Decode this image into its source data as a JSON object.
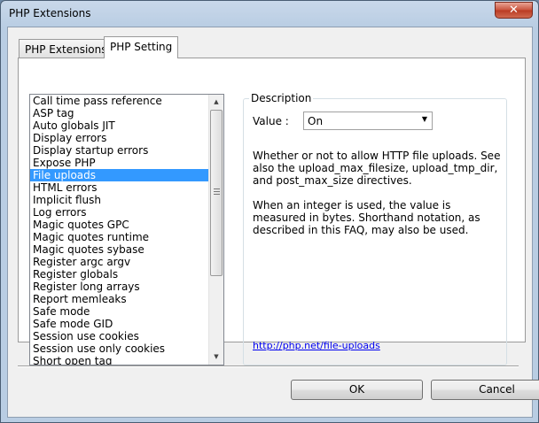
{
  "window": {
    "title": "PHP Extensions",
    "close_glyph": "✕"
  },
  "tabs": [
    {
      "label": "PHP Extensions",
      "active": false
    },
    {
      "label": "PHP Setting",
      "active": true
    }
  ],
  "settings_list": {
    "items": [
      "Call time pass reference",
      "ASP tag",
      "Auto globals JIT",
      "Display errors",
      "Display startup errors",
      "Expose PHP",
      "File uploads",
      "HTML errors",
      "Implicit flush",
      "Log errors",
      "Magic quotes GPC",
      "Magic quotes runtime",
      "Magic quotes sybase",
      "Register argc argv",
      "Register globals",
      "Register long arrays",
      "Report memleaks",
      "Safe mode",
      "Safe mode GID",
      "Session use cookies",
      "Session use only cookies",
      "Short open tag"
    ],
    "selected": "File uploads",
    "selection_color": "#3399ff"
  },
  "description": {
    "legend": "Description",
    "value_label": "Value :",
    "value_selected": "On",
    "paragraph_1": "Whether or not to allow HTTP file uploads. See also the upload_max_filesize, upload_tmp_dir, and post_max_size directives.",
    "paragraph_2": "When an integer is used, the value is measured in bytes. Shorthand notation, as described in this FAQ, may also be used.",
    "link": "http://php.net/file-uploads"
  },
  "buttons": {
    "ok": "OK",
    "cancel": "Cancel"
  }
}
